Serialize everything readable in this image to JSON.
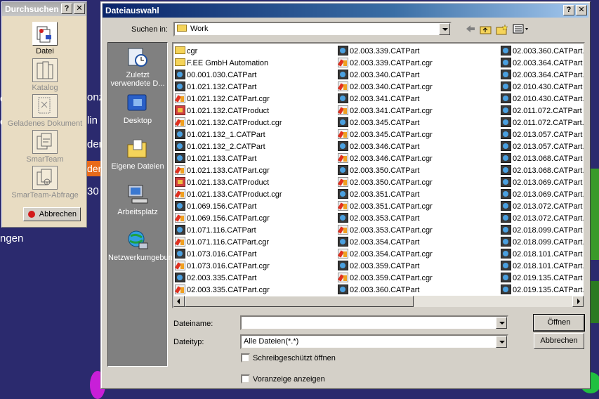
{
  "background": {
    "fragments": [
      "c",
      "onz",
      "c",
      "lin",
      "der",
      "der",
      "30",
      "ngen"
    ]
  },
  "browse_panel": {
    "title": "Durchsuchen",
    "help_label": "?",
    "close_label": "✕",
    "tools": [
      {
        "label": "Datei",
        "enabled": true
      },
      {
        "label": "Katalog",
        "enabled": false
      },
      {
        "label": "Geladenes Dokument",
        "enabled": false
      },
      {
        "label": "SmarTeam",
        "enabled": false
      },
      {
        "label": "SmarTeam-Abfrage",
        "enabled": false
      }
    ],
    "abort_label": "Abbrechen"
  },
  "dialog": {
    "title": "Dateiauswahl",
    "help_label": "?",
    "close_label": "✕",
    "look_in_label": "Suchen in:",
    "look_in_value": "Work",
    "places": [
      {
        "label": "Zuletzt verwendete D..."
      },
      {
        "label": "Desktop"
      },
      {
        "label": "Eigene Dateien"
      },
      {
        "label": "Arbeitsplatz"
      },
      {
        "label": "Netzwerkumgebung"
      }
    ],
    "files": {
      "col1": [
        {
          "name": "cgr",
          "type": "folder"
        },
        {
          "name": "F.EE GmbH Automation",
          "type": "folder"
        },
        {
          "name": "00.001.030.CATPart",
          "type": "part"
        },
        {
          "name": "01.021.132.CATPart",
          "type": "part"
        },
        {
          "name": "01.021.132.CATPart.cgr",
          "type": "cgr"
        },
        {
          "name": "01.021.132.CATProduct",
          "type": "product"
        },
        {
          "name": "01.021.132.CATProduct.cgr",
          "type": "cgr"
        },
        {
          "name": "01.021.132_1.CATPart",
          "type": "part"
        },
        {
          "name": "01.021.132_2.CATPart",
          "type": "part"
        },
        {
          "name": "01.021.133.CATPart",
          "type": "part"
        },
        {
          "name": "01.021.133.CATPart.cgr",
          "type": "cgr"
        },
        {
          "name": "01.021.133.CATProduct",
          "type": "product"
        },
        {
          "name": "01.021.133.CATProduct.cgr",
          "type": "cgr"
        },
        {
          "name": "01.069.156.CATPart",
          "type": "part"
        },
        {
          "name": "01.069.156.CATPart.cgr",
          "type": "cgr"
        },
        {
          "name": "01.071.116.CATPart",
          "type": "part"
        },
        {
          "name": "01.071.116.CATPart.cgr",
          "type": "cgr"
        },
        {
          "name": "01.073.016.CATPart",
          "type": "part"
        },
        {
          "name": "01.073.016.CATPart.cgr",
          "type": "cgr"
        },
        {
          "name": "02.003.335.CATPart",
          "type": "part"
        },
        {
          "name": "02.003.335.CATPart.cgr",
          "type": "cgr"
        }
      ],
      "col2": [
        {
          "name": "02.003.339.CATPart",
          "type": "part"
        },
        {
          "name": "02.003.339.CATPart.cgr",
          "type": "cgr"
        },
        {
          "name": "02.003.340.CATPart",
          "type": "part"
        },
        {
          "name": "02.003.340.CATPart.cgr",
          "type": "cgr"
        },
        {
          "name": "02.003.341.CATPart",
          "type": "part"
        },
        {
          "name": "02.003.341.CATPart.cgr",
          "type": "cgr"
        },
        {
          "name": "02.003.345.CATPart",
          "type": "part"
        },
        {
          "name": "02.003.345.CATPart.cgr",
          "type": "cgr"
        },
        {
          "name": "02.003.346.CATPart",
          "type": "part"
        },
        {
          "name": "02.003.346.CATPart.cgr",
          "type": "cgr"
        },
        {
          "name": "02.003.350.CATPart",
          "type": "part"
        },
        {
          "name": "02.003.350.CATPart.cgr",
          "type": "cgr"
        },
        {
          "name": "02.003.351.CATPart",
          "type": "part"
        },
        {
          "name": "02.003.351.CATPart.cgr",
          "type": "cgr"
        },
        {
          "name": "02.003.353.CATPart",
          "type": "part"
        },
        {
          "name": "02.003.353.CATPart.cgr",
          "type": "cgr"
        },
        {
          "name": "02.003.354.CATPart",
          "type": "part"
        },
        {
          "name": "02.003.354.CATPart.cgr",
          "type": "cgr"
        },
        {
          "name": "02.003.359.CATPart",
          "type": "part"
        },
        {
          "name": "02.003.359.CATPart.cgr",
          "type": "cgr"
        },
        {
          "name": "02.003.360.CATPart",
          "type": "part"
        }
      ],
      "col3": [
        {
          "name": "02.003.360.CATPart.",
          "type": "part"
        },
        {
          "name": "02.003.364.CATPart",
          "type": "part"
        },
        {
          "name": "02.003.364.CATPart.",
          "type": "part"
        },
        {
          "name": "02.010.430.CATPart",
          "type": "part"
        },
        {
          "name": "02.010.430.CATPart.",
          "type": "part"
        },
        {
          "name": "02.011.072.CATPart",
          "type": "part"
        },
        {
          "name": "02.011.072.CATPart.",
          "type": "part"
        },
        {
          "name": "02.013.057.CATPart",
          "type": "part"
        },
        {
          "name": "02.013.057.CATPart.",
          "type": "part"
        },
        {
          "name": "02.013.068.CATPart",
          "type": "part"
        },
        {
          "name": "02.013.068.CATPart.",
          "type": "part"
        },
        {
          "name": "02.013.069.CATPart",
          "type": "part"
        },
        {
          "name": "02.013.069.CATPart.",
          "type": "part"
        },
        {
          "name": "02.013.072.CATPart",
          "type": "part"
        },
        {
          "name": "02.013.072.CATPart.",
          "type": "part"
        },
        {
          "name": "02.018.099.CATPart",
          "type": "part"
        },
        {
          "name": "02.018.099.CATPart.",
          "type": "part"
        },
        {
          "name": "02.018.101.CATPart",
          "type": "part"
        },
        {
          "name": "02.018.101.CATPart.",
          "type": "part"
        },
        {
          "name": "02.019.135.CATPart",
          "type": "part"
        },
        {
          "name": "02.019.135.CATPart.",
          "type": "part"
        }
      ]
    },
    "filename_label": "Dateiname:",
    "filename_value": "",
    "filetype_label": "Dateityp:",
    "filetype_value": "Alle Dateien(*.*)",
    "open_label": "Öffnen",
    "cancel_label": "Abbrechen",
    "readonly_label": "Schreibgeschützt öffnen",
    "readonly_checked": false,
    "preview_label": "Voranzeige anzeigen",
    "preview_checked": false
  },
  "colors": {
    "desktop": "#2b2a6e",
    "title_active": "#0a246a",
    "title_inactive": "#a8a8a8",
    "panel": "#e8dcc2",
    "dialog": "#d4d0c8"
  }
}
